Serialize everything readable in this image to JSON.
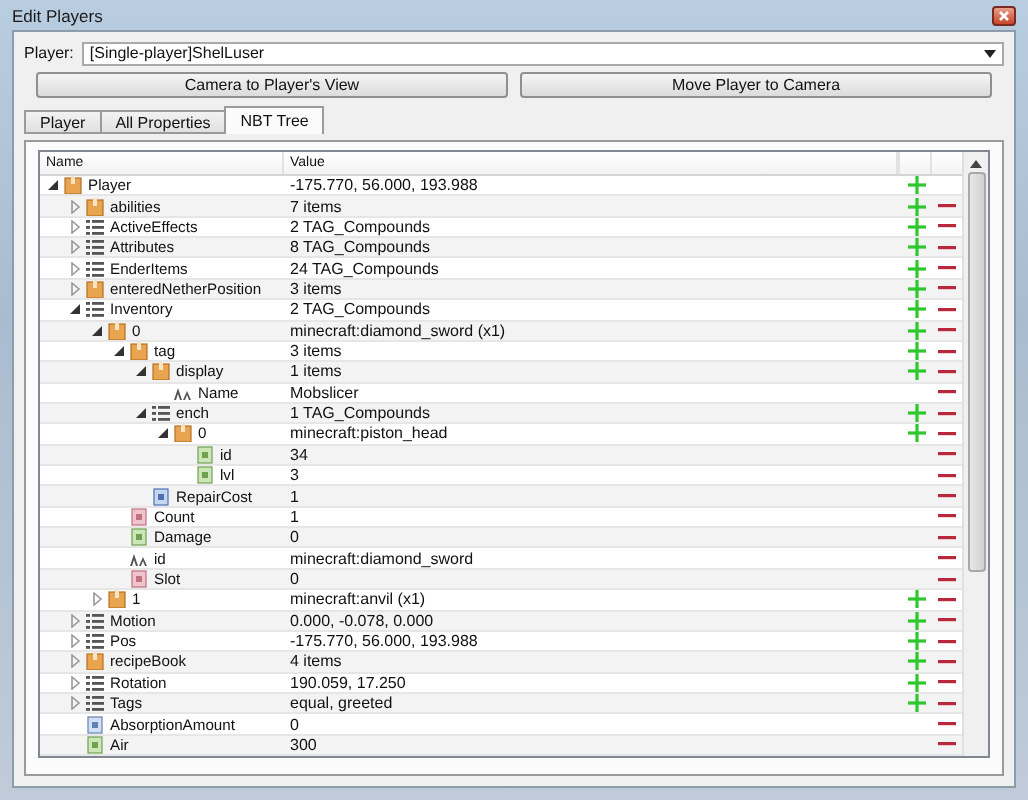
{
  "window": {
    "title": "Edit Players"
  },
  "player": {
    "label": "Player:",
    "value": "[Single-player]ShelLuser"
  },
  "buttons": [
    "Camera to Player's View",
    "Move Player to Camera"
  ],
  "tabs": [
    {
      "label": "Player",
      "selected": false
    },
    {
      "label": "All Properties",
      "selected": false
    },
    {
      "label": "NBT Tree",
      "selected": true
    }
  ],
  "tree": {
    "columns": [
      "Name",
      "Value"
    ],
    "nodes": [
      {
        "name": "Player",
        "value": "-175.770, 56.000, 193.988",
        "kind": "compound",
        "expanded": true,
        "children": [
          {
            "name": "abilities",
            "value": "7 items",
            "kind": "compound",
            "expanded": false
          },
          {
            "name": "ActiveEffects",
            "value": "2 TAG_Compounds",
            "kind": "list",
            "expanded": false
          },
          {
            "name": "Attributes",
            "value": "8 TAG_Compounds",
            "kind": "list",
            "expanded": false
          },
          {
            "name": "EnderItems",
            "value": "24 TAG_Compounds",
            "kind": "list",
            "expanded": false
          },
          {
            "name": "enteredNetherPosition",
            "value": "3 items",
            "kind": "compound",
            "expanded": false
          },
          {
            "name": "Inventory",
            "value": "2 TAG_Compounds",
            "kind": "list",
            "expanded": true,
            "children": [
              {
                "name": "0",
                "value": "minecraft:diamond_sword (x1)",
                "kind": "compound",
                "expanded": true,
                "children": [
                  {
                    "name": "tag",
                    "value": "3 items",
                    "kind": "compound",
                    "expanded": true,
                    "children": [
                      {
                        "name": "display",
                        "value": "1 items",
                        "kind": "compound",
                        "expanded": true,
                        "children": [
                          {
                            "name": "Name",
                            "value": "Mobslicer",
                            "kind": "string"
                          }
                        ]
                      },
                      {
                        "name": "ench",
                        "value": "1 TAG_Compounds",
                        "kind": "list",
                        "expanded": true,
                        "children": [
                          {
                            "name": "0",
                            "value": "minecraft:piston_head",
                            "kind": "compound",
                            "expanded": true,
                            "children": [
                              {
                                "name": "id",
                                "value": "34",
                                "kind": "short"
                              },
                              {
                                "name": "lvl",
                                "value": "3",
                                "kind": "short"
                              }
                            ]
                          }
                        ]
                      },
                      {
                        "name": "RepairCost",
                        "value": "1",
                        "kind": "int"
                      }
                    ]
                  },
                  {
                    "name": "Count",
                    "value": "1",
                    "kind": "byte"
                  },
                  {
                    "name": "Damage",
                    "value": "0",
                    "kind": "short"
                  },
                  {
                    "name": "id",
                    "value": "minecraft:diamond_sword",
                    "kind": "string"
                  },
                  {
                    "name": "Slot",
                    "value": "0",
                    "kind": "byte"
                  }
                ]
              },
              {
                "name": "1",
                "value": "minecraft:anvil (x1)",
                "kind": "compound",
                "expanded": false
              }
            ]
          },
          {
            "name": "Motion",
            "value": "0.000, -0.078, 0.000",
            "kind": "list",
            "expanded": false
          },
          {
            "name": "Pos",
            "value": "-175.770, 56.000, 193.988",
            "kind": "list",
            "expanded": false
          },
          {
            "name": "recipeBook",
            "value": "4 items",
            "kind": "compound",
            "expanded": false
          },
          {
            "name": "Rotation",
            "value": "190.059, 17.250",
            "kind": "list",
            "expanded": false
          },
          {
            "name": "Tags",
            "value": "equal, greeted",
            "kind": "list",
            "expanded": false
          },
          {
            "name": "AbsorptionAmount",
            "value": "0",
            "kind": "float"
          },
          {
            "name": "Air",
            "value": "300",
            "kind": "short"
          }
        ]
      }
    ]
  }
}
